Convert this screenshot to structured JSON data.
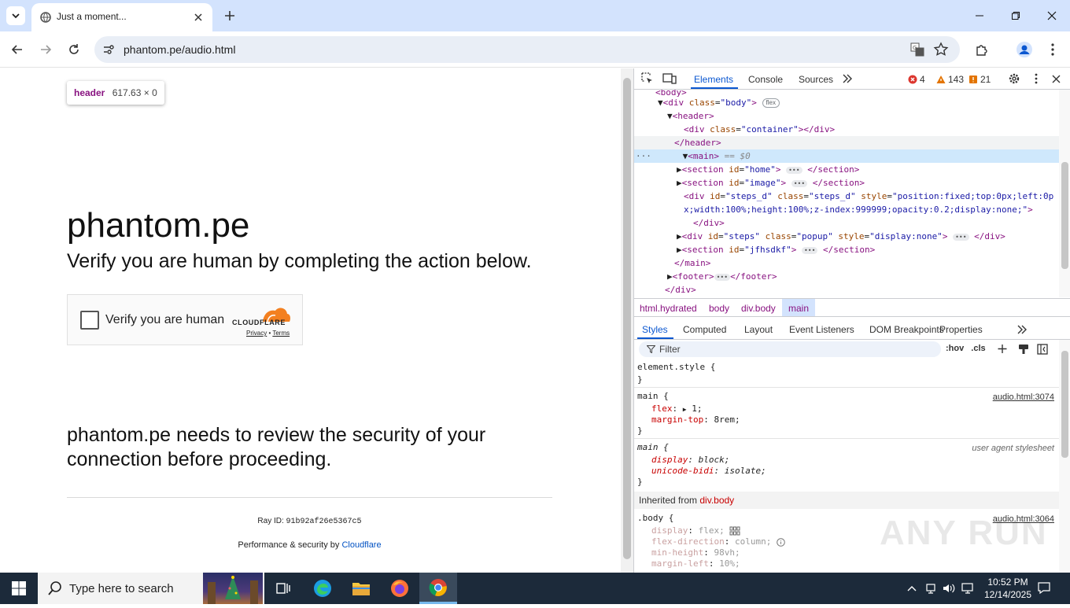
{
  "browser": {
    "tab_title": "Just a moment...",
    "url": "phantom.pe/audio.html"
  },
  "page": {
    "inspect_tooltip": {
      "tag": "header",
      "size": "617.63 × 0"
    },
    "site_title": "phantom.pe",
    "verify_heading": "Verify you are human by completing the action below.",
    "turnstile": {
      "checkbox_label": "Verify you are human",
      "logo_text": "CLOUDFLARE",
      "privacy": "Privacy",
      "sep": " • ",
      "terms": "Terms"
    },
    "review_text": "phantom.pe needs to review the security of your connection before proceeding.",
    "ray_label": "Ray ID: ",
    "ray_id": "91b92af26e5367c5",
    "perf_label": "Performance & security by ",
    "perf_link": "Cloudflare"
  },
  "devtools": {
    "tabs": [
      "Elements",
      "Console",
      "Sources"
    ],
    "errors": "4",
    "warnings": "143",
    "issues": "21",
    "breadcrumbs": [
      "html.hydrated",
      "body",
      "div.body",
      "main"
    ],
    "styles_tabs": [
      "Styles",
      "Computed",
      "Layout",
      "Event Listeners",
      "DOM Breakpoints",
      "Properties"
    ],
    "filter_placeholder": "Filter",
    "hov": ":hov",
    "cls": ".cls",
    "rules": {
      "element_style": "element.style {",
      "close": "}",
      "main_sel": "main {",
      "main_src": "audio.html:3074",
      "flex_prop": "flex",
      "flex_val": "1;",
      "mt_prop": "margin-top",
      "mt_val": "8rem;",
      "ua_sel": "main {",
      "ua_src": "user agent stylesheet",
      "display_prop": "display",
      "display_val": "block;",
      "bidi_prop": "unicode-bidi",
      "bidi_val": "isolate;",
      "inherited_label": "Inherited from ",
      "inherited_sel": "div.body",
      "body_sel": ".body {",
      "body_src": "audio.html:3064",
      "b_display_prop": "display",
      "b_display_val": "flex;",
      "b_fd_prop": "flex-direction",
      "b_fd_val": "column;",
      "b_mh_prop": "min-height",
      "b_mh_val": "98vh;",
      "b_ml_prop": "margin-left",
      "b_ml_val": "10%;"
    },
    "dom": {
      "body_partial": "<body>",
      "div_body_tag": "div",
      "div_body_attr": "class",
      "div_body_val": "\"body\"",
      "flex_badge": "flex",
      "header_open": "<header>",
      "container_tag": "div",
      "container_attr": "class",
      "container_val": "\"container\"",
      "header_close": "</header>",
      "main_open": "<main>",
      "main_eq": " == $0",
      "home_attr": "id",
      "home_val": "\"home\"",
      "image_val": "\"image\"",
      "steps_d_id": "\"steps_d\"",
      "steps_d_class": "\"steps_d\"",
      "steps_d_style_a": "\"position:fixed;top:0px;left:0p",
      "steps_d_style_b": "x;width:100%;height:100%;z-index:999999;opacity:0.2;display:none;\"",
      "div_close": "</div>",
      "steps_id": "\"steps\"",
      "steps_class": "\"popup\"",
      "steps_style": "\"display:none\"",
      "jfh_val": "\"jfhsdkf\"",
      "main_close": "</main>",
      "footer_open": "<footer>",
      "footer_close": "</footer>",
      "section_close": "</section>",
      "div_body_close": "</div>"
    },
    "watermark": "ANY RUN"
  },
  "taskbar": {
    "search_placeholder": "Type here to search",
    "time": "10:52 PM",
    "date": "12/14/2025"
  }
}
